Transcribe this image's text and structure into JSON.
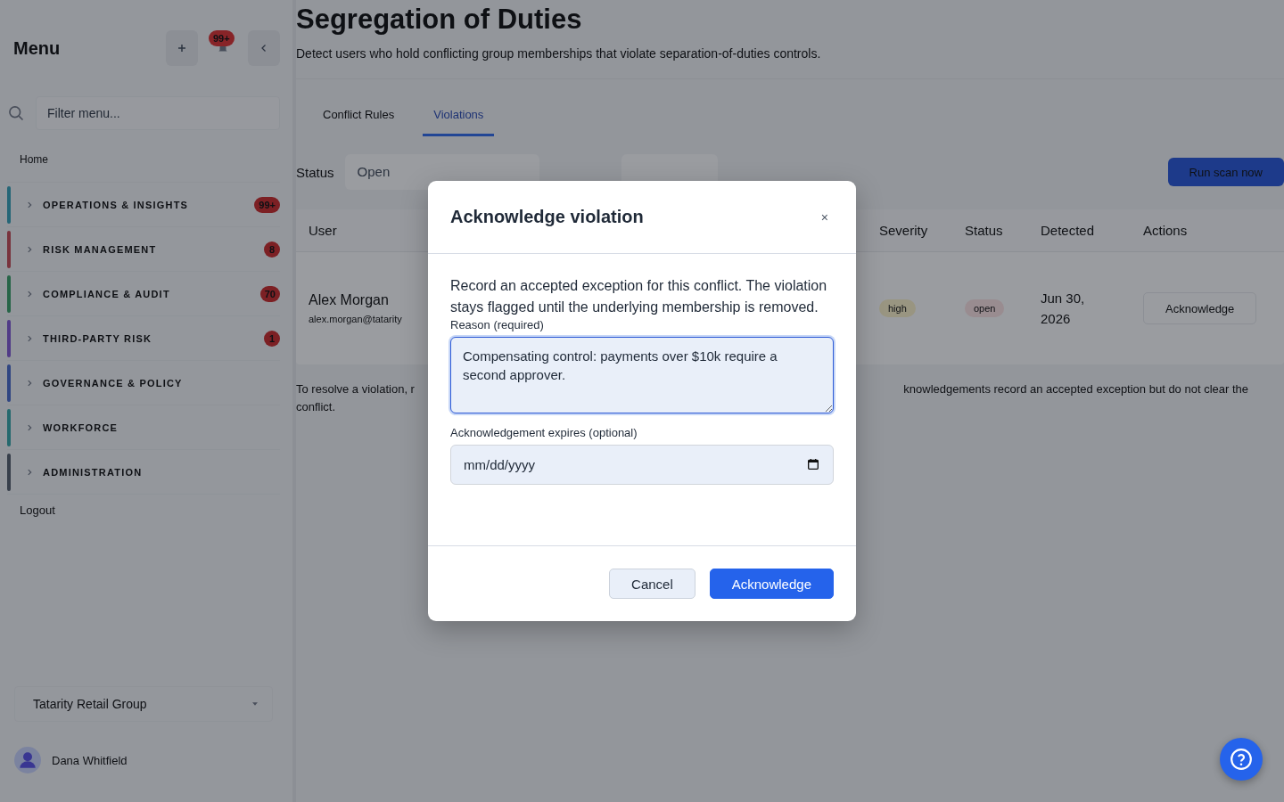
{
  "sidebar": {
    "title": "Menu",
    "notifications_badge": "99+",
    "filter": {
      "placeholder": "Filter menu..."
    },
    "home": "Home",
    "sections": [
      {
        "label": "OPERATIONS & INSIGHTS",
        "badge": "99+",
        "color": "#256677"
      },
      {
        "label": "RISK MANAGEMENT",
        "badge": "8",
        "color": "#79333d"
      },
      {
        "label": "COMPLIANCE & AUDIT",
        "badge": "70",
        "color": "#276548"
      },
      {
        "label": "THIRD-PARTY RISK",
        "badge": "1",
        "color": "#513b87"
      },
      {
        "label": "GOVERNANCE & POLICY",
        "color": "#304682"
      },
      {
        "label": "WORKFORCE",
        "color": "#25696e"
      },
      {
        "label": "ADMINISTRATION",
        "color": "#373f4b"
      }
    ],
    "logout": "Logout",
    "organization": "Tatarity Retail Group",
    "user": "Dana Whitfield"
  },
  "page": {
    "title": "Segregation of Duties",
    "subtitle": "Detect users who hold conflicting group memberships that violate separation-of-duties controls.",
    "tabs": [
      {
        "label": "Conflict Rules",
        "selected": false
      },
      {
        "label": "Violations",
        "selected": true
      }
    ],
    "filter": {
      "label": "Status",
      "value": "Open"
    },
    "run_button": "Run scan now",
    "table": {
      "columns": [
        "User",
        "Severity",
        "Status",
        "Detected",
        "Actions"
      ],
      "rows": [
        {
          "user": "Alex Morgan",
          "email": "alex.morgan@tatarity",
          "severity": "high",
          "status": "open",
          "detected": "Jun 30, 2026",
          "action": "Acknowledge"
        }
      ]
    },
    "note_left": [
      "To resolve a violation, r",
      "conflict."
    ],
    "note_right": "knowledgements record an accepted exception but do not clear the"
  },
  "dialog": {
    "title": "Acknowledge violation",
    "close": "×",
    "description": "Record an accepted exception for this conflict. The violation stays flagged until the underlying membership is removed.",
    "reason": {
      "label": "Reason (required)",
      "value": "Compensating control: payments over $10k require a second approver."
    },
    "expires": {
      "label": "Acknowledgement expires (optional)",
      "placeholder": "mm/dd/yyyy"
    },
    "buttons": [
      {
        "label": "Cancel",
        "kind": "secondary"
      },
      {
        "label": "Acknowledge",
        "kind": "primary"
      }
    ]
  }
}
